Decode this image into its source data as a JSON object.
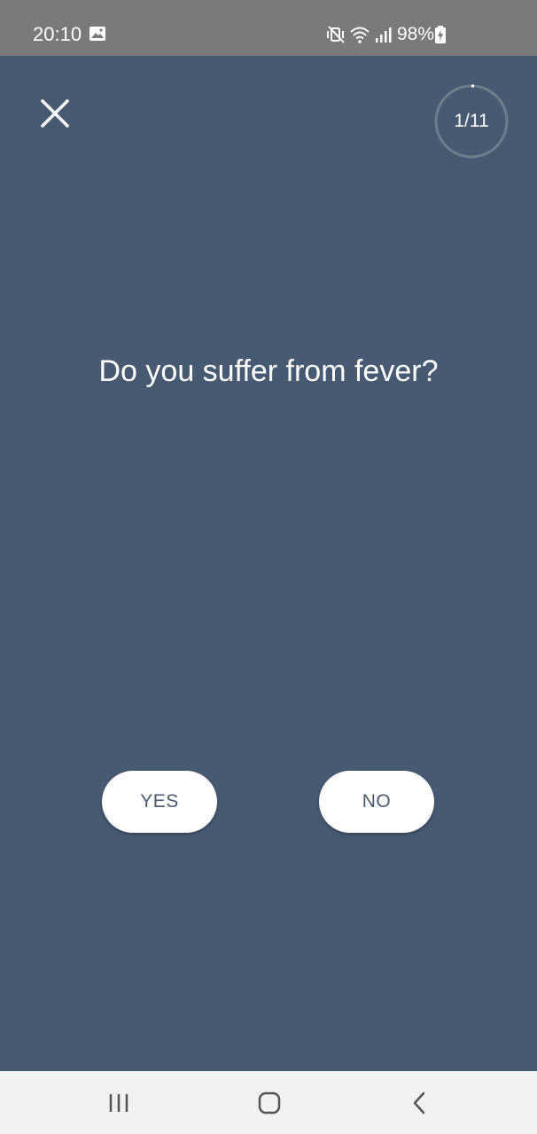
{
  "status_bar": {
    "time": "20:10",
    "battery": "98%",
    "icons": [
      "gallery-icon",
      "mute-vibrate-icon",
      "wifi-icon",
      "signal-icon",
      "battery-charging-icon"
    ]
  },
  "header": {
    "close_icon": "close-icon",
    "progress_label": "1/11",
    "progress_fraction": 0.0909
  },
  "question": {
    "text": "Do you suffer from fever?"
  },
  "answers": {
    "yes_label": "YES",
    "no_label": "NO"
  },
  "nav_bar": {
    "icons": [
      "recent-apps-icon",
      "home-icon",
      "back-icon"
    ]
  },
  "colors": {
    "background": "#485a72",
    "status_bar": "#7a7a7a",
    "button": "#ffffff",
    "button_text": "#485a72",
    "nav_bar": "#f1f1f1"
  }
}
